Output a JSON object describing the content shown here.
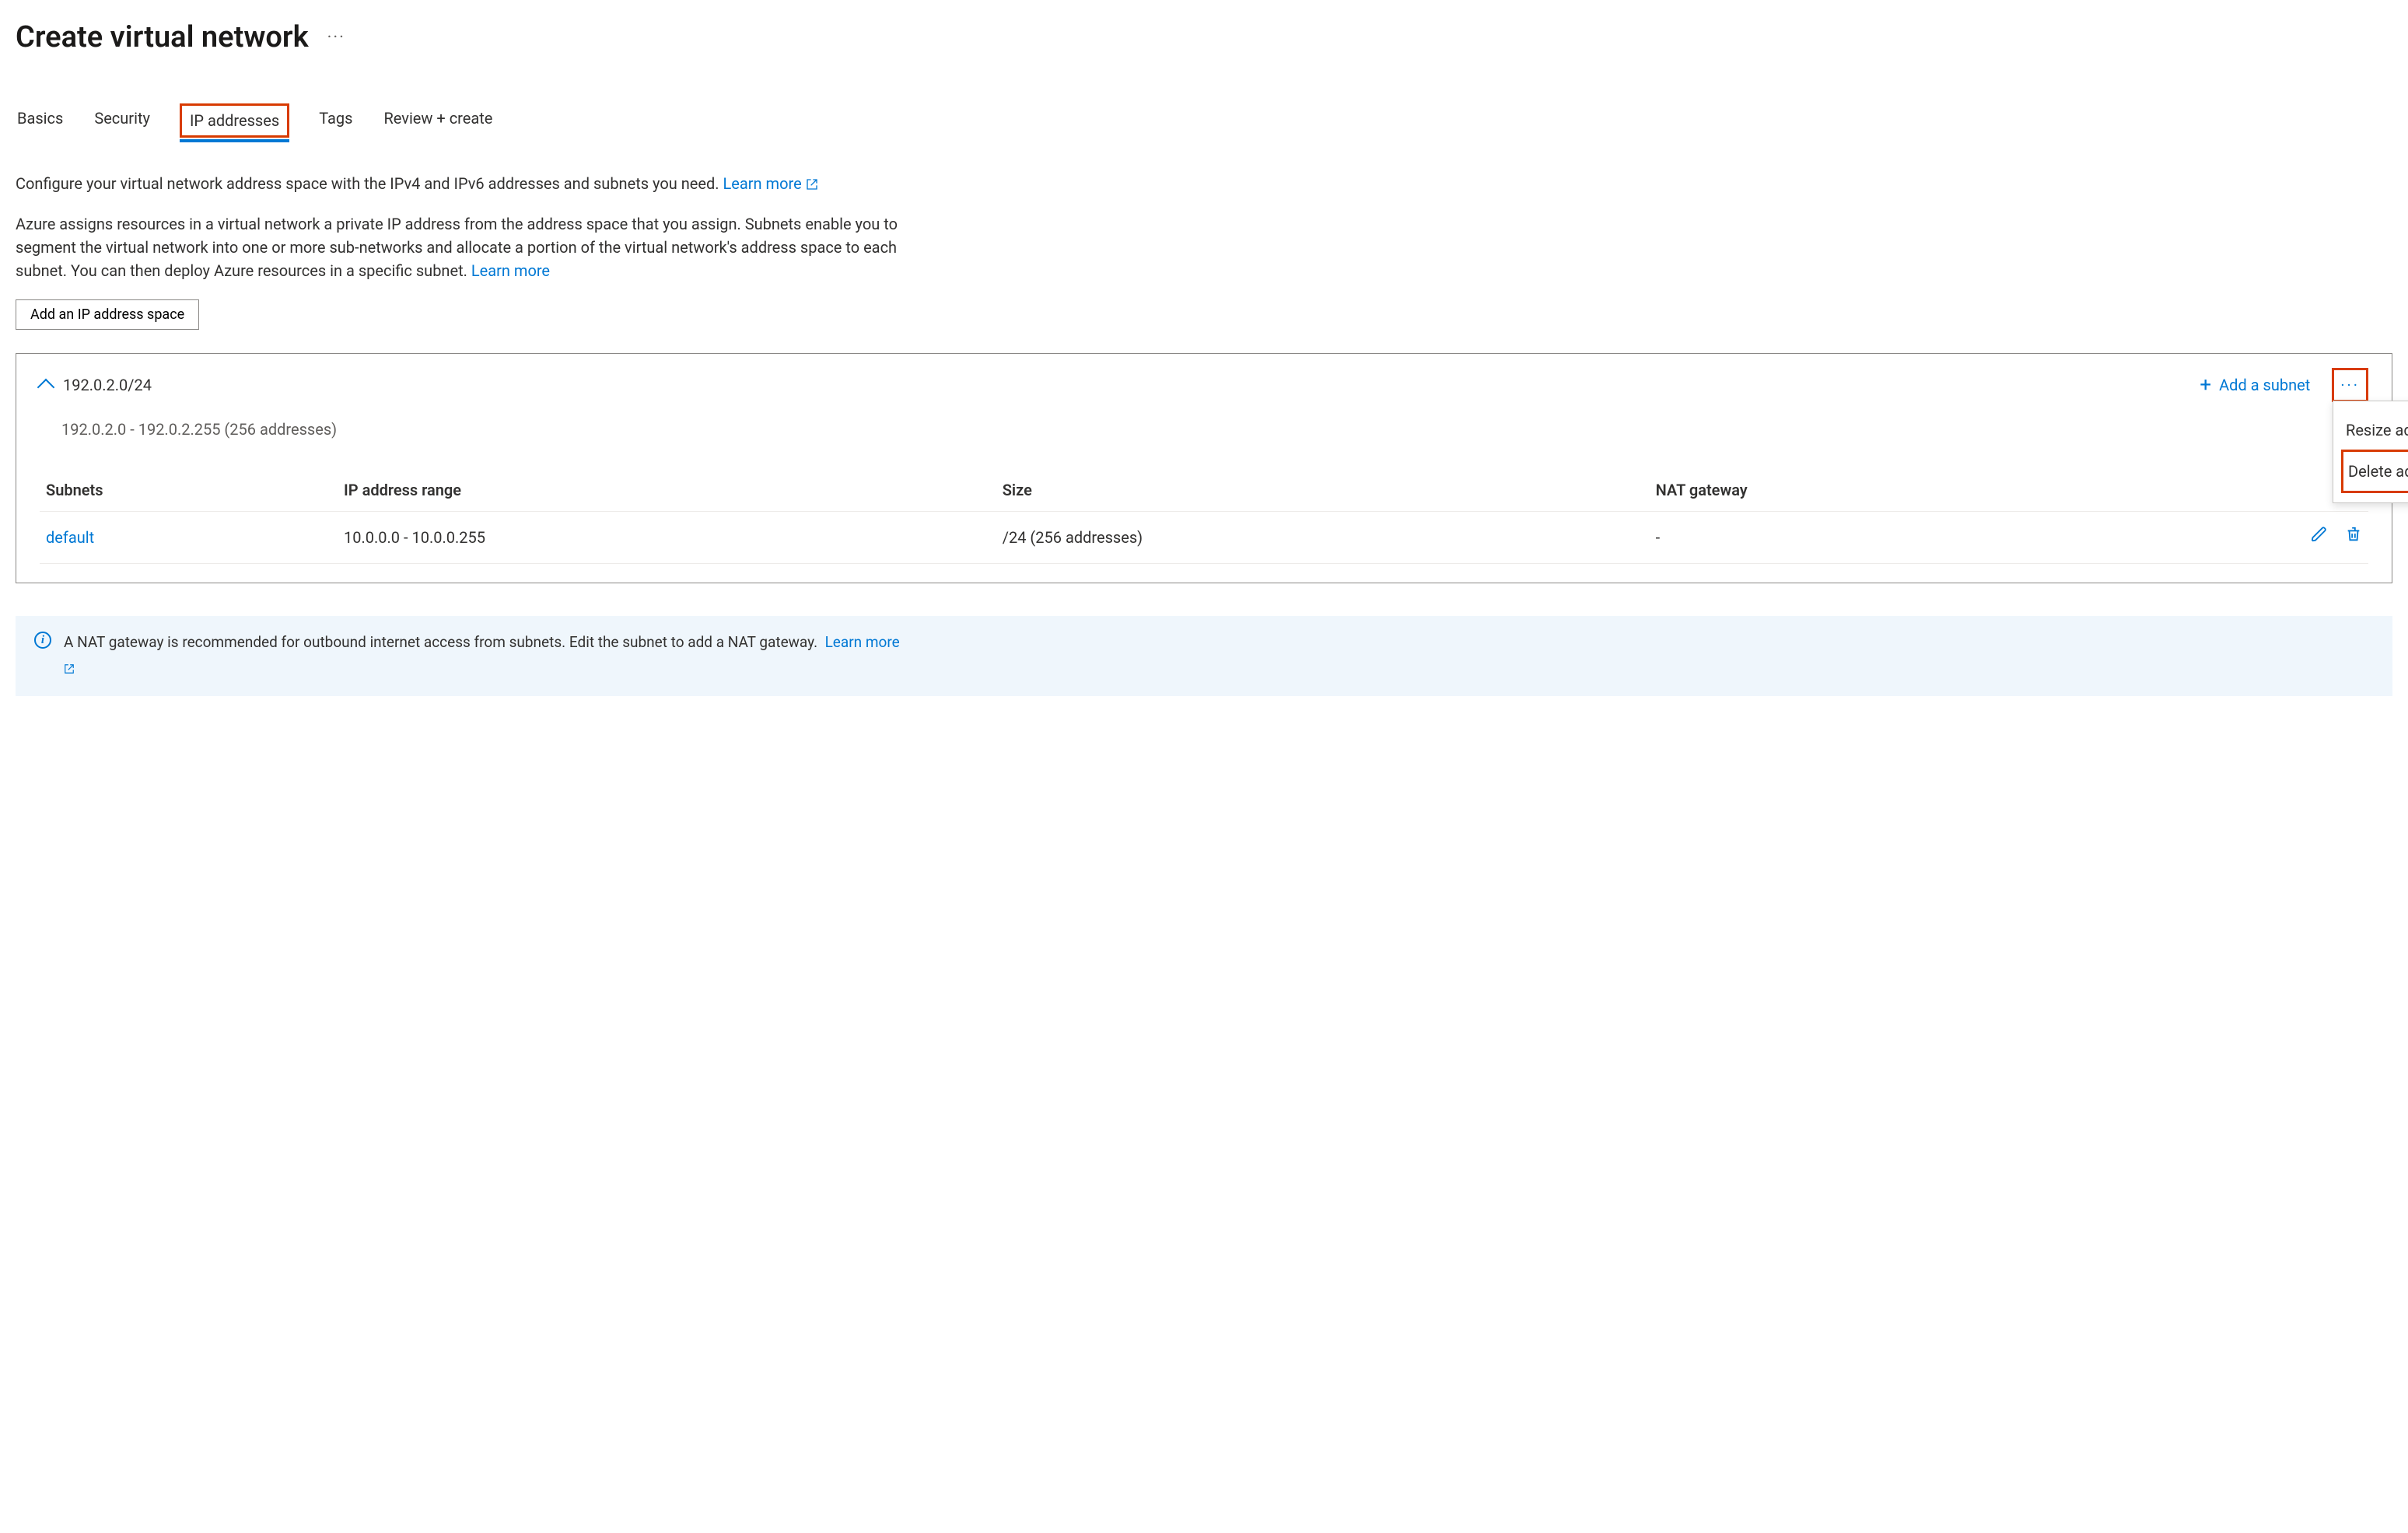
{
  "header": {
    "title": "Create virtual network"
  },
  "tabs": {
    "basics": "Basics",
    "security": "Security",
    "ip": "IP addresses",
    "tags": "Tags",
    "review": "Review + create"
  },
  "intro": {
    "line1": "Configure your virtual network address space with the IPv4 and IPv6 addresses and subnets you need.",
    "learn1": "Learn more",
    "line2": "Azure assigns resources in a virtual network a private IP address from the address space that you assign. Subnets enable you to segment the virtual network into one or more sub-networks and allocate a portion of the virtual network's address space to each subnet. You can then deploy Azure resources in a specific subnet.",
    "learn2": "Learn more"
  },
  "buttons": {
    "add_space": "Add an IP address space",
    "add_subnet": "Add a subnet"
  },
  "address_space": {
    "cidr": "192.0.2.0/24",
    "range": "192.0.2.0 - 192.0.2.255 (256 addresses)"
  },
  "table": {
    "col_subnets": "Subnets",
    "col_range": "IP address range",
    "col_size": "Size",
    "col_nat": "NAT gateway",
    "row": {
      "name": "default",
      "range": "10.0.0.0 - 10.0.0.255",
      "size": "/24 (256 addresses)",
      "nat": "-"
    }
  },
  "menu": {
    "resize": "Resize address space",
    "delete": "Delete address space"
  },
  "banner": {
    "text": "A NAT gateway is recommended for outbound internet access from subnets. Edit the subnet to add a NAT gateway.",
    "learn": "Learn more"
  }
}
